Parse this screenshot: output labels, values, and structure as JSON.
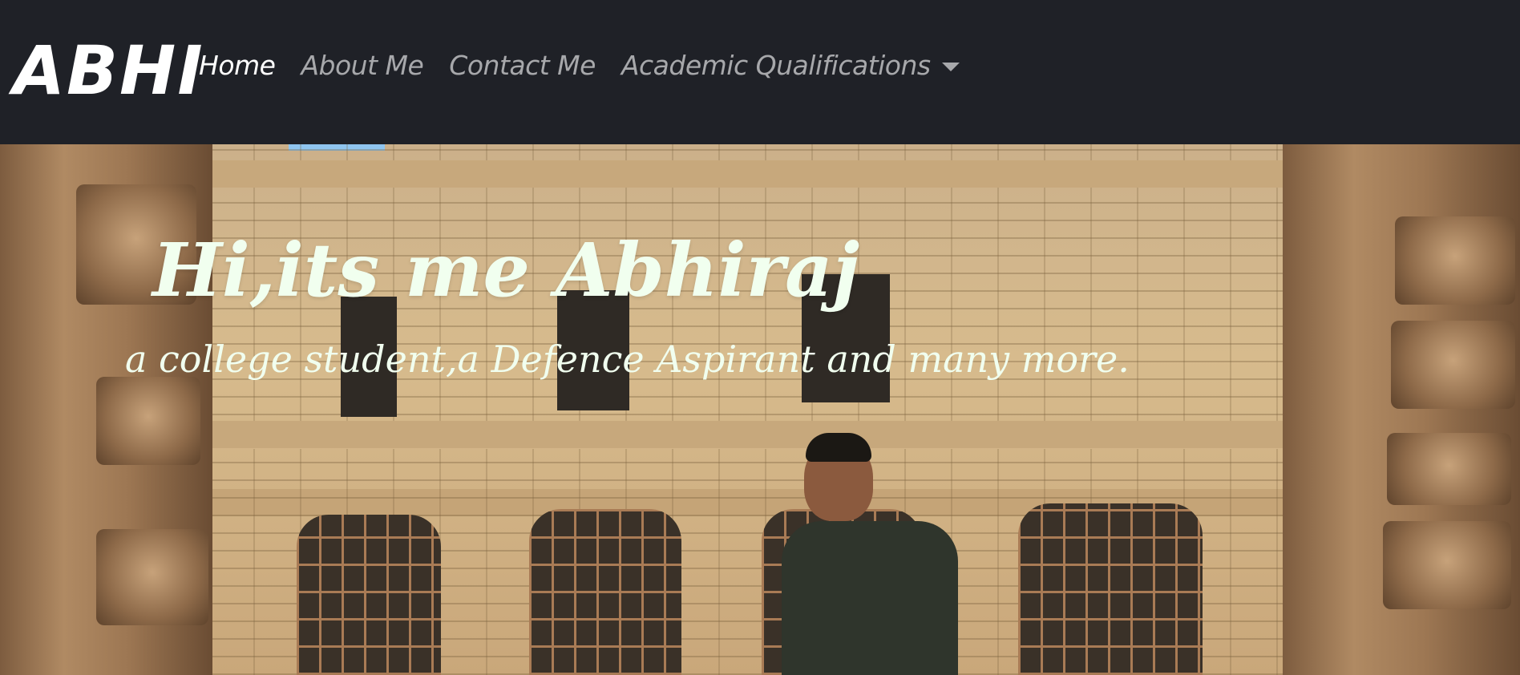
{
  "brand": "ABHI",
  "nav": {
    "items": [
      {
        "label": "Home",
        "active": true
      },
      {
        "label": "About Me",
        "active": false
      },
      {
        "label": "Contact Me",
        "active": false
      },
      {
        "label": "Academic Qualifications",
        "active": false,
        "dropdown": true
      }
    ]
  },
  "hero": {
    "title": "Hi,its me Abhiraj",
    "subtitle": "a college student,a Defence Aspirant and many more."
  },
  "colors": {
    "navbar_bg": "#1f2127",
    "nav_active": "#ffffff",
    "nav_inactive": "#a7a8ab",
    "hero_text": "#f1ffef"
  }
}
